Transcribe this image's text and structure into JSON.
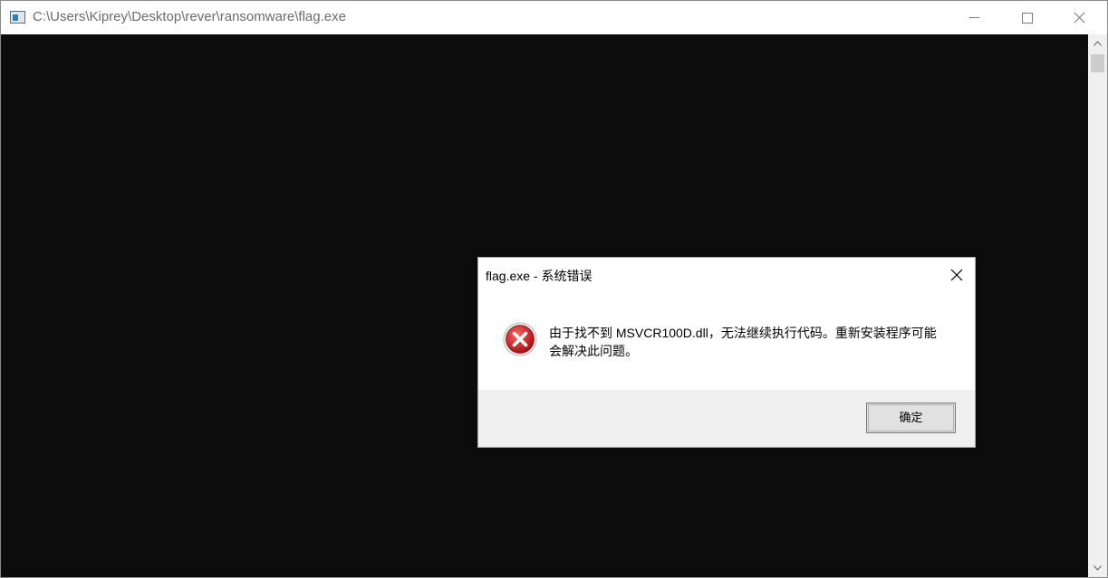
{
  "window": {
    "title": "C:\\Users\\Kiprey\\Desktop\\rever\\ransomware\\flag.exe",
    "icon": "console-app-icon",
    "controls": [
      "minimize-icon",
      "maximize-icon",
      "close-icon"
    ],
    "console_background": "#0c0c0c"
  },
  "scrollbar": {
    "icons": [
      "scroll-up-arrow-icon",
      "scroll-down-arrow-icon"
    ]
  },
  "dialog": {
    "title": "flag.exe - 系统错误",
    "icon": "error-icon",
    "message_line1": "由于找不到 MSVCR100D.dll，无法继续执行代码。重新安装程序可能",
    "message_line2": "会解决此问题。",
    "ok_label": "确定",
    "error_color": "#d32f2f"
  }
}
